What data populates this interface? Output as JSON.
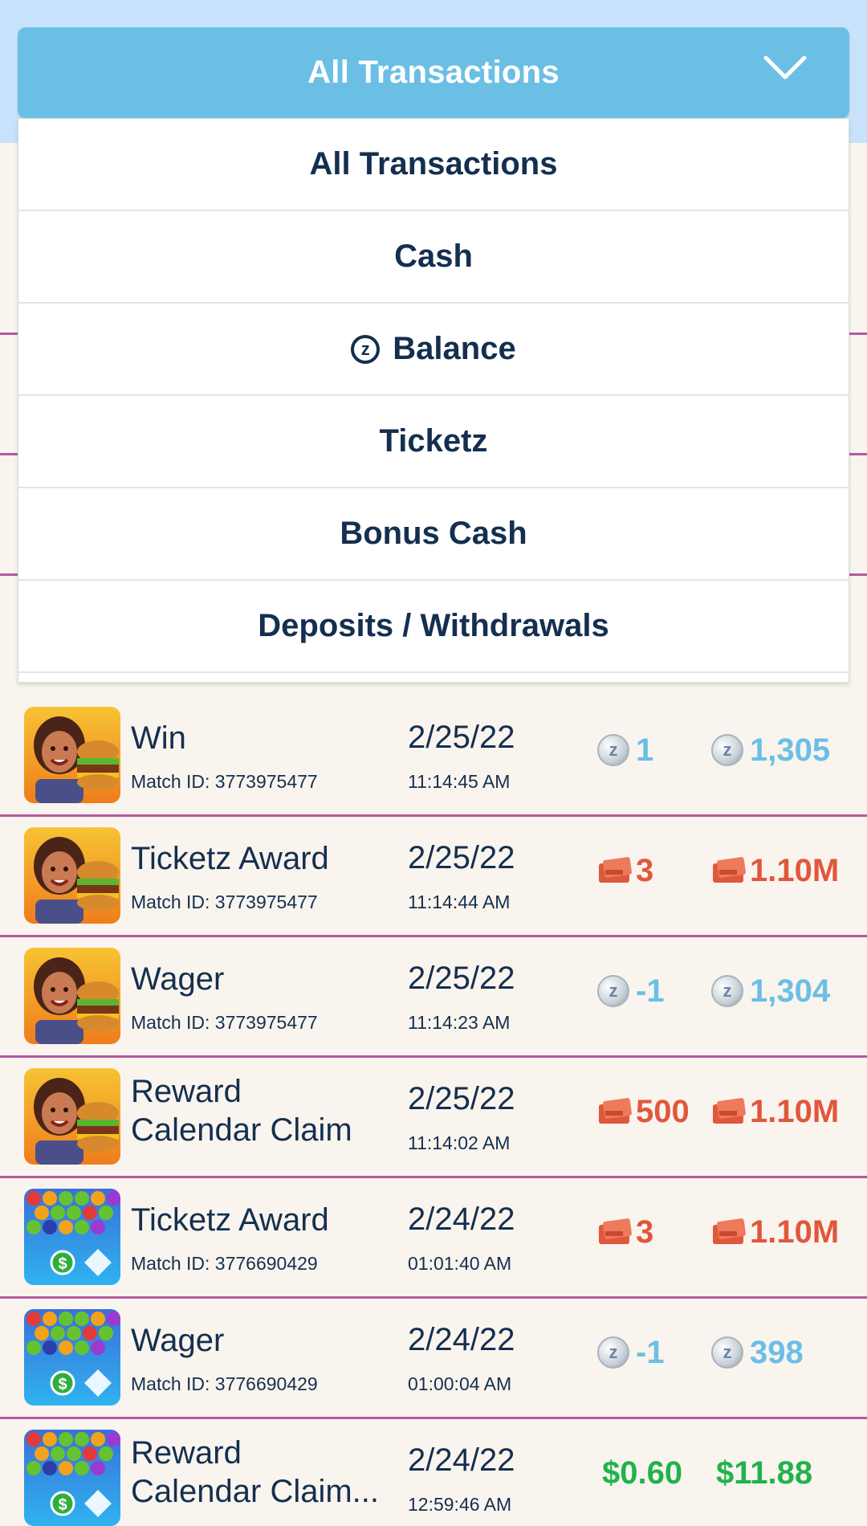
{
  "header": {
    "title": "All Transactions"
  },
  "menu": {
    "options": [
      "All Transactions",
      "Cash",
      "Balance",
      "Ticketz",
      "Bonus Cash",
      "Deposits / Withdrawals"
    ],
    "balance_icon_glyph": "z"
  },
  "coin_glyph": "z",
  "transactions": [
    {
      "game": "burger",
      "title": "Win",
      "sub": "Match ID: 3773975477",
      "date": "2/25/22",
      "time": "11:14:45 AM",
      "currency": "z",
      "amount": "1",
      "balance": "1,305"
    },
    {
      "game": "burger",
      "title": "Ticketz Award",
      "sub": "Match ID: 3773975477",
      "date": "2/25/22",
      "time": "11:14:44 AM",
      "currency": "ticket",
      "amount": "3",
      "balance": "1.10M"
    },
    {
      "game": "burger",
      "title": "Wager",
      "sub": "Match ID: 3773975477",
      "date": "2/25/22",
      "time": "11:14:23 AM",
      "currency": "z",
      "amount": "-1",
      "balance": "1,304"
    },
    {
      "game": "burger",
      "title_line1": "Reward",
      "title_line2": "Calendar Claim",
      "date": "2/25/22",
      "time": "11:14:02 AM",
      "currency": "ticket",
      "amount": "500",
      "balance": "1.10M"
    },
    {
      "game": "bubble",
      "title": "Ticketz Award",
      "sub": "Match ID: 3776690429",
      "date": "2/24/22",
      "time": "01:01:40 AM",
      "currency": "ticket",
      "amount": "3",
      "balance": "1.10M"
    },
    {
      "game": "bubble",
      "title": "Wager",
      "sub": "Match ID: 3776690429",
      "date": "2/24/22",
      "time": "01:00:04 AM",
      "currency": "z",
      "amount": "-1",
      "balance": "398"
    },
    {
      "game": "bubble",
      "title_line1": "Reward",
      "title_line2": "Calendar Claim...",
      "date": "2/24/22",
      "time": "12:59:46 AM",
      "currency": "cash",
      "amount": "$0.60",
      "balance": "$11.88"
    }
  ],
  "colors": {
    "header": "#6bbfe5",
    "navy": "#142f4f",
    "z_blue": "#6bbfe5",
    "ticket_red": "#e0583c",
    "cash_green": "#20b34b",
    "divider": "#b5599d"
  }
}
